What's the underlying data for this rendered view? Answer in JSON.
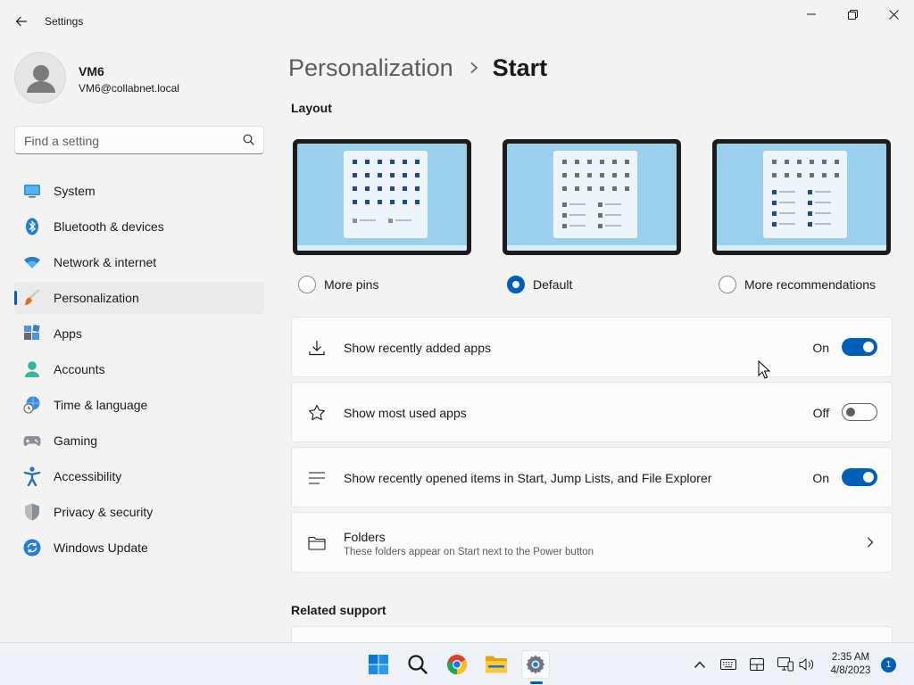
{
  "window": {
    "title": "Settings"
  },
  "user": {
    "name": "VM6",
    "email": "VM6@collabnet.local"
  },
  "search": {
    "placeholder": "Find a setting"
  },
  "sidebar": {
    "items": [
      {
        "label": "System",
        "icon": "system-icon"
      },
      {
        "label": "Bluetooth & devices",
        "icon": "bluetooth-icon"
      },
      {
        "label": "Network & internet",
        "icon": "wifi-icon"
      },
      {
        "label": "Personalization",
        "icon": "brush-icon",
        "selected": true
      },
      {
        "label": "Apps",
        "icon": "apps-icon"
      },
      {
        "label": "Accounts",
        "icon": "accounts-icon"
      },
      {
        "label": "Time & language",
        "icon": "globe-clock-icon"
      },
      {
        "label": "Gaming",
        "icon": "gamepad-icon"
      },
      {
        "label": "Accessibility",
        "icon": "accessibility-icon"
      },
      {
        "label": "Privacy & security",
        "icon": "shield-icon"
      },
      {
        "label": "Windows Update",
        "icon": "update-icon"
      }
    ]
  },
  "main": {
    "breadcrumb": {
      "parent": "Personalization",
      "current": "Start"
    },
    "layout_heading": "Layout",
    "layouts": [
      {
        "label": "More pins",
        "selected": false
      },
      {
        "label": "Default",
        "selected": true
      },
      {
        "label": "More recommendations",
        "selected": false
      }
    ],
    "settings": [
      {
        "label": "Show recently added apps",
        "state": "On",
        "icon": "download-icon"
      },
      {
        "label": "Show most used apps",
        "state": "Off",
        "icon": "star-icon"
      },
      {
        "label": "Show recently opened items in Start, Jump Lists, and File Explorer",
        "state": "On",
        "icon": "list-icon"
      }
    ],
    "folders": {
      "title": "Folders",
      "description": "These folders appear on Start next to the Power button",
      "icon": "folder-icon"
    },
    "related_heading": "Related support"
  },
  "taskbar": {
    "apps": [
      "start-icon",
      "search-icon",
      "chrome-icon",
      "file-explorer-icon",
      "settings-icon"
    ],
    "active_app": "settings-icon",
    "clock": {
      "time": "2:35 AM",
      "date": "4/8/2023"
    },
    "notification_count": "1"
  },
  "colors": {
    "accent": "#005fb8",
    "background": "#f3f3f3",
    "card": "#fbfbfb"
  }
}
